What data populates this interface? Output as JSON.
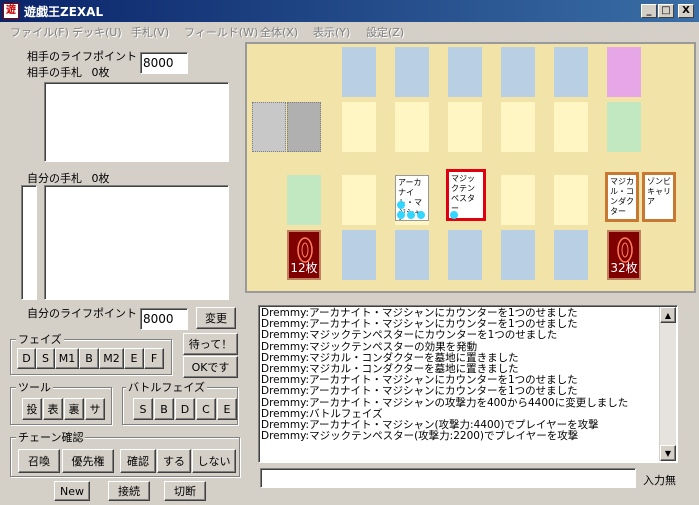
{
  "window": {
    "title": "遊戯王ZEXAL",
    "icon_text": "遊",
    "minimize": "_",
    "maximize": "□",
    "close": "X"
  },
  "menu": [
    "ファイル(F)",
    "デッキ(U)",
    "手札(V)",
    "フィールド(W)",
    "全体(X)",
    "表示(Y)",
    "設定(Z)"
  ],
  "opponent": {
    "lp_label": "相手のライフポイント",
    "lp_value": "8000",
    "hand_label": "相手の手札",
    "hand_count": "0枚"
  },
  "player": {
    "hand_label": "自分の手札",
    "hand_count": "0枚",
    "lp_label": "自分のライフポイント",
    "lp_value": "8000",
    "change_button": "変更"
  },
  "phase": {
    "label": "フェイズ",
    "buttons": [
      "D",
      "S",
      "M1",
      "B",
      "M2",
      "E",
      "F"
    ]
  },
  "wait_button": "待って！",
  "ok_button": "OKです",
  "tools": {
    "label": "ツール",
    "buttons": [
      "投",
      "表",
      "裏",
      "サ"
    ]
  },
  "battle_phase": {
    "label": "バトルフェイズ",
    "buttons": [
      "S",
      "B",
      "D",
      "C",
      "E"
    ]
  },
  "chain": {
    "label": "チェーン確認",
    "buttons": [
      "召喚",
      "優先権",
      "確認",
      "する",
      "しない"
    ]
  },
  "bottom_buttons": [
    "New",
    "接続",
    "切断"
  ],
  "field": {
    "opp_deck_count": "12枚",
    "my_deck_count": "32枚",
    "cards": {
      "arcanite": "アーカナイト・マジシャン",
      "magic_tempester": "マジックテンペスター",
      "magical_conductor": "マジカル・コンダクター",
      "zombie_carrier": "ゾンビキャリア"
    }
  },
  "log": [
    "Dremmy:アーカナイト・マジシャンにカウンターを1つのせました",
    "Dremmy:アーカナイト・マジシャンにカウンターを1つのせました",
    "Dremmy:マジックテンペスターにカウンターを1つのせました",
    "Dremmy:マジックテンペスターの効果を発動",
    "Dremmy:マジカル・コンダクターを墓地に置きました",
    "Dremmy:マジカル・コンダクターを墓地に置きました",
    "Dremmy:アーカナイト・マジシャンにカウンターを1つのせました",
    "Dremmy:アーカナイト・マジシャンにカウンターを1つのせました",
    "Dremmy:アーカナイト・マジシャンの攻撃力を400から4400に変更しました",
    "Dremmy:バトルフェイズ",
    "Dremmy:アーカナイト・マジシャン(攻撃力:4400)でプレイヤーを攻撃",
    "Dremmy:マジックテンペスター(攻撃力:2200)でプレイヤーを攻撃"
  ],
  "input": {
    "value": "",
    "status": "入力無"
  }
}
